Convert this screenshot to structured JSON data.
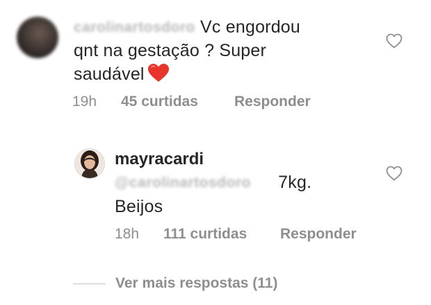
{
  "comment": {
    "handle": "carolinartosdoro",
    "text_line1": "Vc engordou",
    "text_line2": "qnt na gestação ? Super",
    "text_line3": "saudável",
    "time": "19h",
    "likes": "45 curtidas",
    "reply_label": "Responder"
  },
  "reply": {
    "username": "mayracardi",
    "mention": "@carolinartosdoro",
    "text_line1": "7kg.",
    "text_line2": "Beijos",
    "time": "18h",
    "likes": "111 curtidas",
    "reply_label": "Responder"
  },
  "view_more_label": "Ver mais respostas (11)",
  "colors": {
    "text": "#262626",
    "meta": "#8e8e8e",
    "emoji_heart": "#e8352b"
  },
  "icons": [
    "heart-outline-icon",
    "red-heart-emoji"
  ]
}
